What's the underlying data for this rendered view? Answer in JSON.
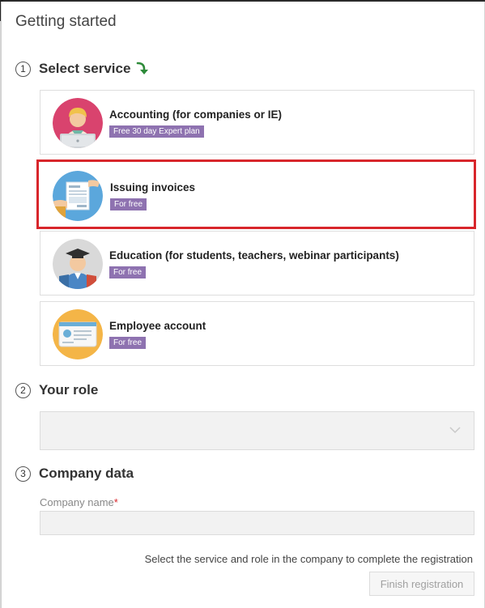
{
  "dialog": {
    "title": "Getting started"
  },
  "steps": [
    {
      "number": "1",
      "title": "Select service"
    },
    {
      "number": "2",
      "title": "Your role"
    },
    {
      "number": "3",
      "title": "Company data"
    }
  ],
  "services": [
    {
      "title": "Accounting (for companies or IE)",
      "badge": "Free 30 day Expert plan",
      "selected": false,
      "icon": "accountant-avatar-icon"
    },
    {
      "title": "Issuing invoices",
      "badge": "For free",
      "selected": true,
      "icon": "invoice-avatar-icon"
    },
    {
      "title": "Education (for students, teachers, webinar participants)",
      "badge": "For free",
      "selected": false,
      "icon": "graduate-avatar-icon"
    },
    {
      "title": "Employee account",
      "badge": "For free",
      "selected": false,
      "icon": "employee-card-avatar-icon"
    }
  ],
  "role": {
    "value": ""
  },
  "company": {
    "name_label": "Company name",
    "required_mark": "*",
    "name_value": ""
  },
  "footer": {
    "hint": "Select the service and role in the company to complete the registration",
    "finish_label": "Finish registration"
  },
  "colors": {
    "accent_badge": "#8e72b0",
    "selected_border": "#d8262b",
    "arrow_green": "#2e8b3a"
  }
}
